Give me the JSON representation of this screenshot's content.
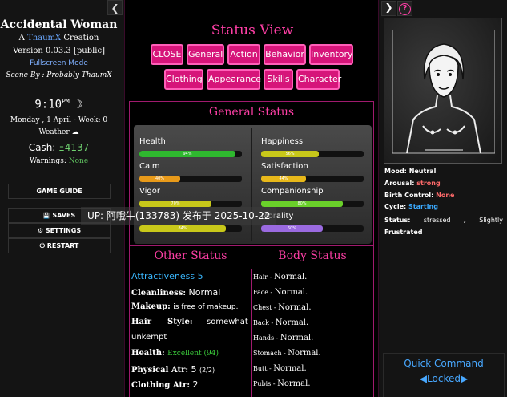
{
  "sidebar": {
    "collapse_icon": "chevron-left-icon",
    "collapse_glyph": "❮",
    "title": "Accidental Woman",
    "creation_a": "A",
    "creation_brand": "ThaumX",
    "creation_rest": "Creation",
    "version": "Version 0.03.3 [public]",
    "fullscreen": "Fullscreen Mode",
    "scene": "Scene By : Probably ThaumX",
    "time": "9:10",
    "time_suffix": "PM",
    "moon_glyph": "☽",
    "date": "Monday , 1 April - Week: 0",
    "weather_label": "Weather",
    "weather_glyph": "☁",
    "cash_label": "Cash:",
    "cash_amount": "Ξ4137",
    "warnings_label": "Warnings:",
    "warnings_value": "None",
    "buttons": {
      "guide": "GAME GUIDE",
      "saves": "SAVES",
      "saves_glyph": "💾",
      "settings": "SETTINGS",
      "settings_glyph": "⚙",
      "restart": "RESTART",
      "restart_glyph": "⏻"
    }
  },
  "center": {
    "title": "Status View",
    "tabs": [
      "CLOSE",
      "General",
      "Action",
      "Behavior",
      "Inventory",
      "Clothing",
      "Appearance",
      "Skills",
      "Character"
    ],
    "general_status_title": "General Status",
    "stats_left": [
      {
        "label": "Health",
        "pct": 94,
        "pct_label": "94%",
        "color": "#2fb82f"
      },
      {
        "label": "Calm",
        "pct": 40,
        "pct_label": "40%",
        "color": "#e89a1a"
      },
      {
        "label": "Vigor",
        "pct": 70,
        "pct_label": "70%",
        "color": "#c8c81a"
      },
      {
        "label": "",
        "pct": 84,
        "pct_label": "84%",
        "color": "#c8c81a"
      }
    ],
    "stats_right": [
      {
        "label": "Happiness",
        "pct": 56,
        "pct_label": "56%",
        "color": "#c8c81a"
      },
      {
        "label": "Satisfaction",
        "pct": 44,
        "pct_label": "44%",
        "color": "#e8b81a"
      },
      {
        "label": "Companionship",
        "pct": 80,
        "pct_label": "80%",
        "color": "#6ad02a"
      },
      {
        "label": "Morality",
        "pct": 60,
        "pct_label": "60%",
        "color": "#9a6ae0"
      }
    ],
    "other_status_title": "Other Status",
    "body_status_title": "Body Status",
    "attractiveness": "Attractiveness 5",
    "cleanliness_label": "Cleanliness:",
    "cleanliness_value": "Normal",
    "makeup_label": "Makeup:",
    "makeup_value": "is free of makeup.",
    "hair_label": "Hair",
    "hair_style_label": "Style:",
    "hair_value_1": "somewhat",
    "hair_value_2": "unkempt",
    "health_label": "Health:",
    "health_value": "Excellent (94)",
    "physical_label": "Physical Atr:",
    "physical_value": "5",
    "physical_sub": "(2/2)",
    "clothing_label": "Clothing Atr:",
    "clothing_value": "2",
    "body": [
      {
        "part": "Hair",
        "value": "Normal."
      },
      {
        "part": "Face",
        "value": "Normal."
      },
      {
        "part": "Chest",
        "value": "Normal."
      },
      {
        "part": "Back",
        "value": "Normal."
      },
      {
        "part": "Hands",
        "value": "Normal."
      },
      {
        "part": "Stomach",
        "value": "Normal."
      },
      {
        "part": "Butt",
        "value": "Normal."
      },
      {
        "part": "Pubis",
        "value": "Normal."
      }
    ]
  },
  "right": {
    "toggle_glyph": "❯",
    "help_glyph": "?",
    "mood_label": "Mood:",
    "mood_value": "Neutral",
    "arousal_label": "Arousal:",
    "arousal_value": "strong",
    "bc_label": "Birth Control:",
    "bc_value": "None",
    "cycle_label": "Cycle:",
    "cycle_value": "Starting",
    "status_label": "Status:",
    "status_value_1": "stressed",
    "status_value_2": ",",
    "status_value_3": "Slightly",
    "status_value_4": "Frustrated",
    "quick_command": "Quick Command",
    "locked": "◀Locked▶"
  },
  "overlay": "UP: 阿哦牛(133783) 发布于 2025-10-22"
}
